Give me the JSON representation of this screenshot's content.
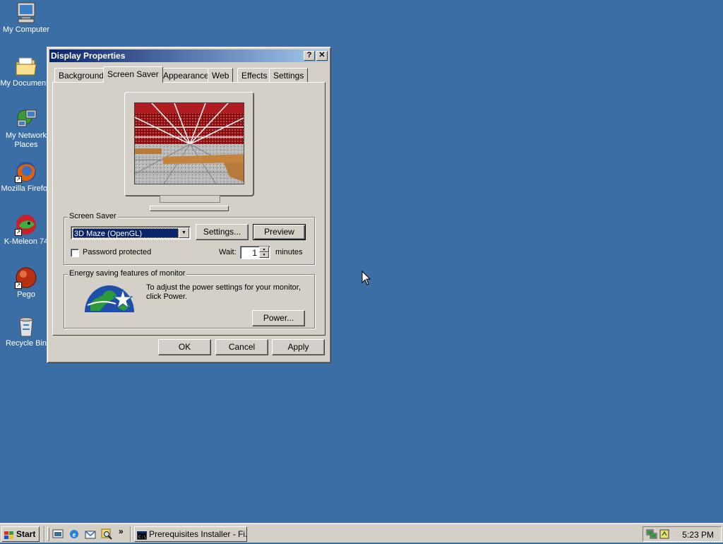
{
  "desktop": {
    "icons": [
      {
        "label": "My Computer",
        "icon": "computer-icon"
      },
      {
        "label": "My Documents",
        "icon": "folder-icon"
      },
      {
        "label": "My Network Places",
        "label_line1": "My Network",
        "label_line2": "Places",
        "icon": "network-icon"
      },
      {
        "label": "Mozilla Firefox",
        "icon": "firefox-icon"
      },
      {
        "label": "K-Meleon 74",
        "icon": "kmeleon-icon"
      },
      {
        "label": "Pego",
        "icon": "pego-icon"
      },
      {
        "label": "Recycle Bin",
        "icon": "recycle-bin-icon"
      }
    ]
  },
  "window": {
    "title": "Display Properties",
    "help_glyph": "?",
    "close_glyph": "✕",
    "tabs": [
      {
        "label": "Background"
      },
      {
        "label": "Screen Saver",
        "active": true
      },
      {
        "label": "Appearance"
      },
      {
        "label": "Web"
      },
      {
        "label": "Effects"
      },
      {
        "label": "Settings"
      }
    ],
    "screensaver_group": {
      "title": "Screen Saver",
      "selected": "3D Maze (OpenGL)",
      "settings_label": "Settings...",
      "preview_label": "Preview",
      "password_label": "Password protected",
      "password_checked": false,
      "wait_label": "Wait:",
      "wait_value": "1",
      "minutes_label": "minutes"
    },
    "energy_group": {
      "title": "Energy saving features of monitor",
      "description": "To adjust the power settings for your monitor, click Power.",
      "power_label": "Power..."
    },
    "buttons": {
      "ok": "OK",
      "cancel": "Cancel",
      "apply": "Apply"
    }
  },
  "taskbar": {
    "start_label": "Start",
    "task_label": "Prerequisites Installer - Fi...",
    "chevron": "»",
    "clock": "5:23 PM"
  },
  "colors": {
    "desktop": "#3a6ea5",
    "face": "#d4d0c8",
    "title_active": "#0a246a",
    "selection": "#0a246a"
  }
}
